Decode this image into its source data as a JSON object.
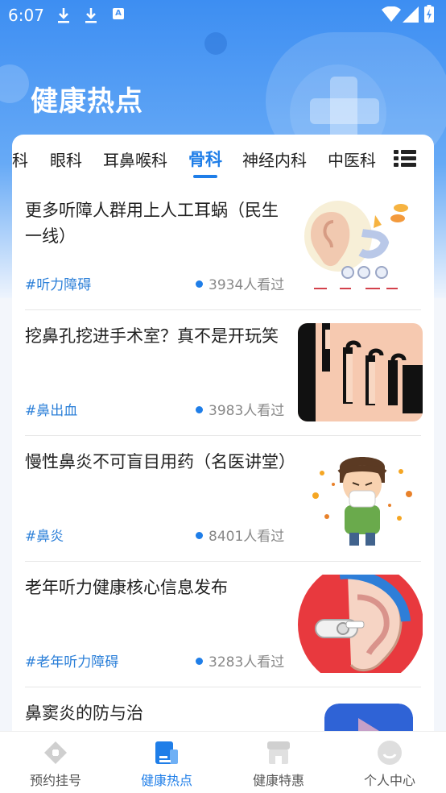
{
  "status_bar": {
    "time": "6:07"
  },
  "header": {
    "title": "健康热点"
  },
  "tabs": [
    {
      "label": "科"
    },
    {
      "label": "眼科"
    },
    {
      "label": "耳鼻喉科"
    },
    {
      "label": "骨科",
      "active": true
    },
    {
      "label": "神经内科"
    },
    {
      "label": "中医科"
    }
  ],
  "articles": [
    {
      "title": "更多听障人群用上人工耳蜗（民生一线）",
      "tag": "#听力障碍",
      "views": "3934人看过"
    },
    {
      "title": "挖鼻孔挖进手术室？真不是开玩笑",
      "tag": "#鼻出血",
      "views": "3983人看过"
    },
    {
      "title": "慢性鼻炎不可盲目用药（名医讲堂）",
      "tag": "#鼻炎",
      "views": "8401人看过"
    },
    {
      "title": "老年听力健康核心信息发布",
      "tag": "#老年听力障碍",
      "views": "3283人看过"
    },
    {
      "title": "鼻窦炎的防与治",
      "tag": "",
      "views": ""
    }
  ],
  "bottom_nav": [
    {
      "label": "预约挂号",
      "icon": "medical-cross-icon"
    },
    {
      "label": "健康热点",
      "icon": "document-icon",
      "active": true
    },
    {
      "label": "健康特惠",
      "icon": "shop-icon"
    },
    {
      "label": "个人中心",
      "icon": "profile-icon"
    }
  ],
  "colors": {
    "accent": "#1f7ee8",
    "header_bg": "#3d8ef2"
  }
}
